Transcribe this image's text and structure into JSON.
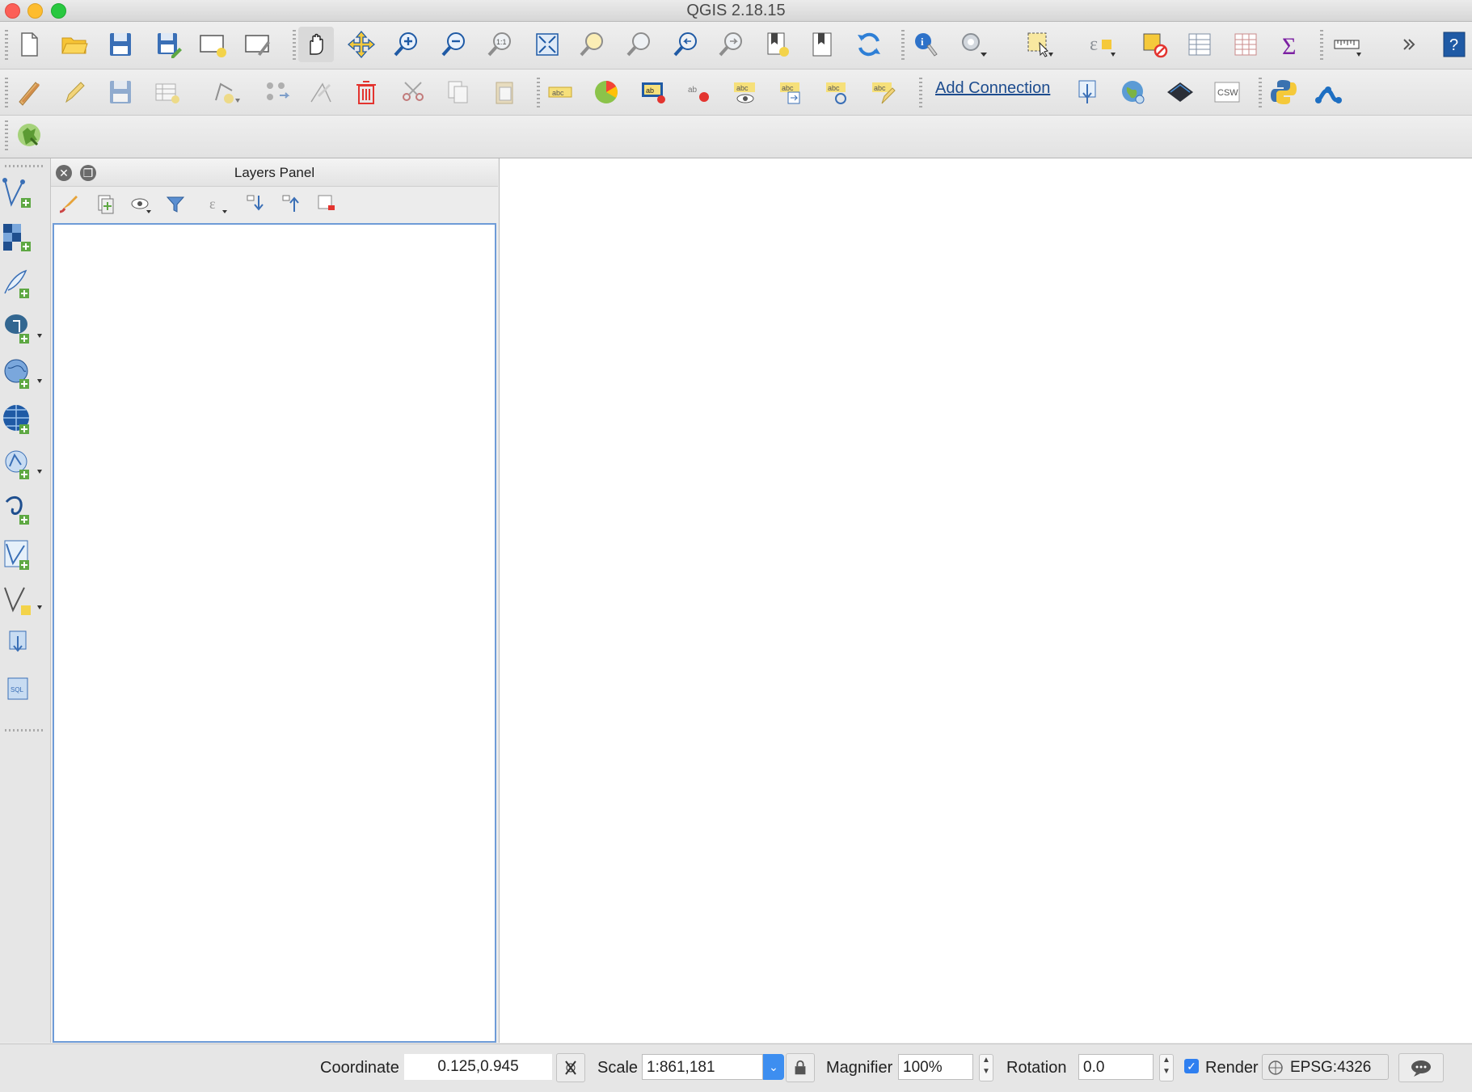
{
  "window": {
    "title": "QGIS 2.18.15"
  },
  "toolbar1": {
    "icons": [
      "new-project-icon",
      "open-project-icon",
      "save-project-icon",
      "save-as-icon",
      "new-print-composer-icon",
      "composer-manager-icon",
      "pan-icon",
      "pan-to-selection-icon",
      "zoom-in-icon",
      "zoom-out-icon",
      "zoom-actual-icon",
      "zoom-full-icon",
      "zoom-to-selection-icon",
      "zoom-to-layer-icon",
      "zoom-last-icon",
      "zoom-next-icon",
      "new-bookmark-icon",
      "show-bookmarks-icon",
      "refresh-icon",
      "identify-icon",
      "run-action-icon",
      "select-features-icon",
      "select-by-expression-icon",
      "deselect-icon",
      "open-attribute-table-icon",
      "field-calculator-icon",
      "statistics-icon",
      "measure-icon",
      "more-icon",
      "help-icon"
    ]
  },
  "toolbar2": {
    "add_connection_label": "Add Connection",
    "icons": [
      "current-edits-icon",
      "toggle-editing-icon",
      "save-edits-icon",
      "digitize-icon",
      "add-feature-icon",
      "move-feature-icon",
      "node-tool-icon",
      "delete-selected-icon",
      "cut-features-icon",
      "copy-features-icon",
      "paste-features-icon",
      "layer-labeling-icon",
      "diagram-icon",
      "label-toolbar-icon",
      "pin-labels-icon",
      "show-hide-labels-icon",
      "move-label-icon",
      "rotate-label-icon",
      "change-label-icon",
      "geoserver-icon",
      "globe-icon",
      "black-tile-icon",
      "csw-icon",
      "python-icon",
      "processing-icon"
    ],
    "csw_text": "CSW"
  },
  "left_toolbar": {
    "icons": [
      "add-vector-layer-icon",
      "add-raster-layer-icon",
      "add-delimited-text-icon",
      "add-postgis-icon",
      "add-spatialite-icon",
      "add-wms-icon",
      "add-wfs-icon",
      "add-oracle-icon",
      "add-virtual-layer-icon",
      "new-shapefile-icon",
      "add-geonode-icon",
      "sql-icon"
    ],
    "sql_text": "SQL"
  },
  "layers_panel": {
    "title": "Layers Panel"
  },
  "statusbar": {
    "coordinate_label": "Coordinate",
    "coordinate_value": "0.125,0.945",
    "scale_label": "Scale",
    "scale_value": "1:861,181",
    "magnifier_label": "Magnifier",
    "magnifier_value": "100%",
    "rotation_label": "Rotation",
    "rotation_value": "0.0",
    "render_label": "Render",
    "render_checked": true,
    "crs_value": "EPSG:4326"
  },
  "colors": {
    "accent": "#3d8ef0",
    "link": "#1d4c8e",
    "panel_focus": "#6e9bd7"
  }
}
